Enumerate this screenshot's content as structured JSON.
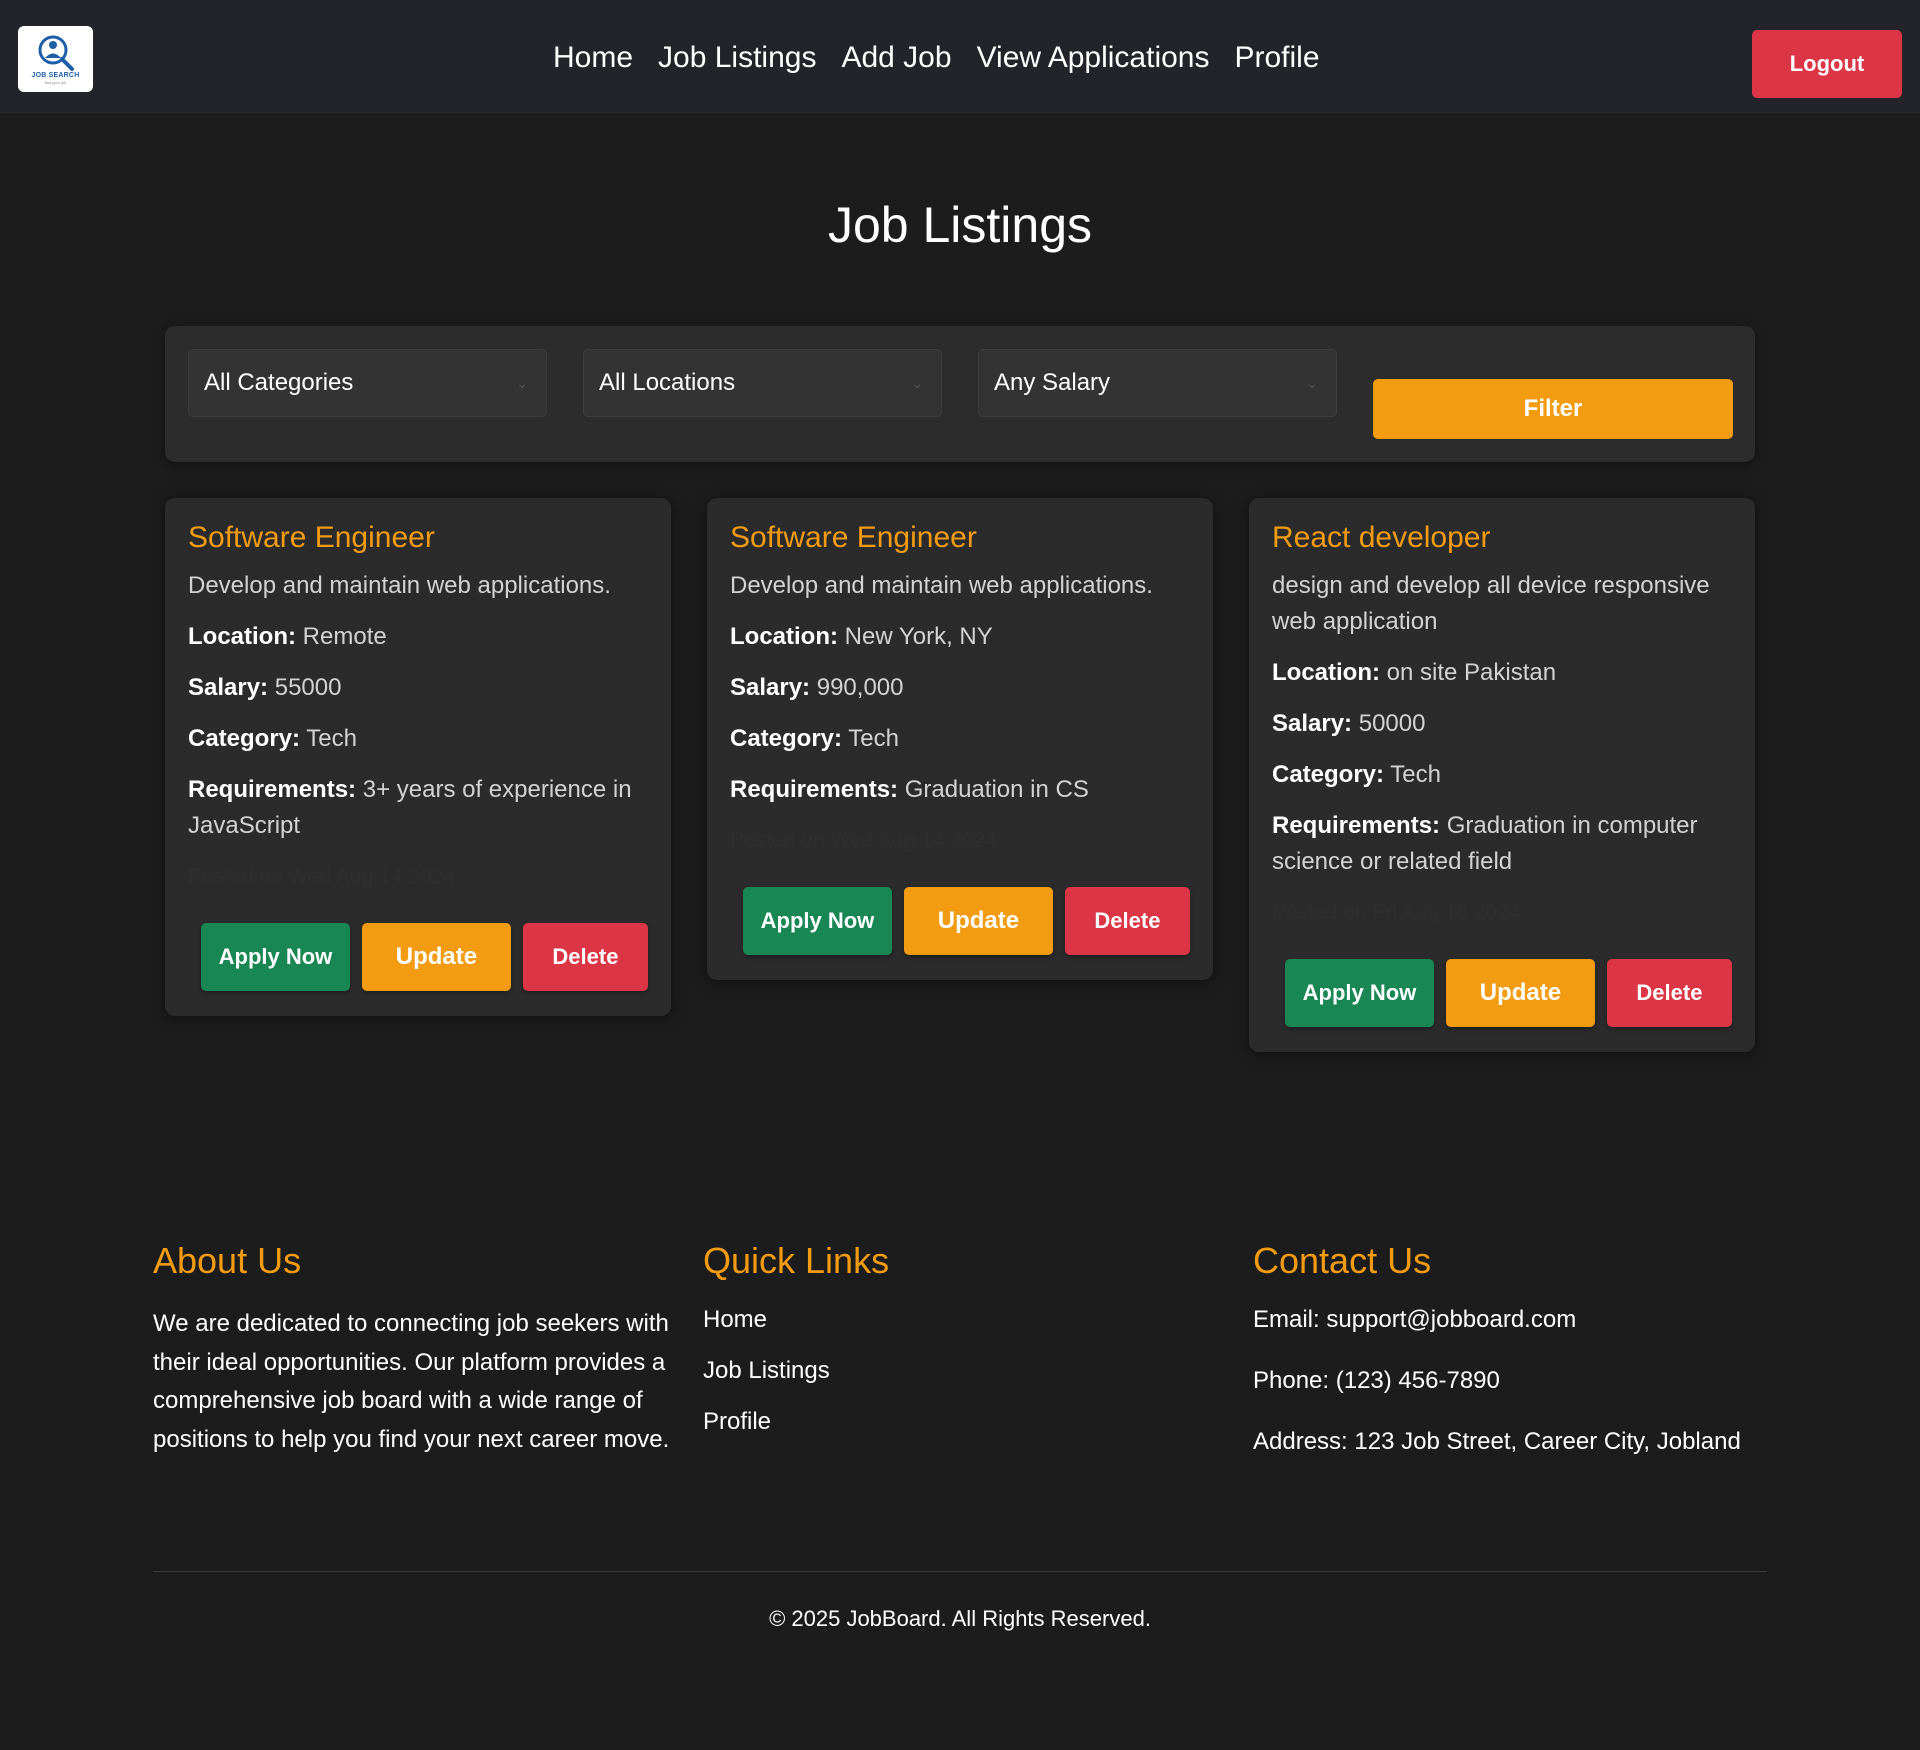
{
  "brand": {
    "logo_text": "JOB SEARCH",
    "logo_subtext": "find your job"
  },
  "nav": {
    "links": [
      "Home",
      "Job Listings",
      "Add Job",
      "View Applications",
      "Profile"
    ],
    "logout_label": "Logout"
  },
  "page": {
    "title": "Job Listings"
  },
  "filters": {
    "category_selected": "All Categories",
    "location_selected": "All Locations",
    "salary_selected": "Any Salary",
    "filter_label": "Filter"
  },
  "labels": {
    "location": "Location:",
    "salary": "Salary:",
    "category": "Category:",
    "requirements": "Requirements:",
    "apply": "Apply Now",
    "update": "Update",
    "delete": "Delete"
  },
  "jobs": [
    {
      "title": "Software Engineer",
      "description": "Develop and maintain web applications.",
      "location": "Remote",
      "salary": "55000",
      "category": "Tech",
      "requirements": "3+ years of experience in JavaScript",
      "posted": "Posted on Wed Aug 14 2024"
    },
    {
      "title": "Software Engineer",
      "description": "Develop and maintain web applications.",
      "location": "New York, NY",
      "salary": "990,000",
      "category": "Tech",
      "requirements": "Graduation in CS",
      "posted": "Posted on Wed Aug 14 2024"
    },
    {
      "title": "React developer",
      "description": "design and develop all device responsive web application",
      "location": "on site Pakistan",
      "salary": "50000",
      "category": "Tech",
      "requirements": "Graduation in computer science or related field",
      "posted": "Posted on Fri Aug 16 2024"
    }
  ],
  "footer": {
    "about": {
      "heading": "About Us",
      "text": "We are dedicated to connecting job seekers with their ideal opportunities. Our platform provides a comprehensive job board with a wide range of positions to help you find your next career move."
    },
    "quick_links": {
      "heading": "Quick Links",
      "links": [
        "Home",
        "Job Listings",
        "Profile"
      ]
    },
    "contact": {
      "heading": "Contact Us",
      "email": "Email: support@jobboard.com",
      "phone": "Phone: (123) 456-7890",
      "address": "Address: 123 Job Street, Career City, Jobland"
    },
    "copyright": "© 2025 JobBoard. All Rights Reserved."
  },
  "colors": {
    "accent": "#f39c12",
    "apply": "#198754",
    "delete": "#dc3545",
    "background": "#1c1c1d",
    "navbar": "#222429"
  }
}
